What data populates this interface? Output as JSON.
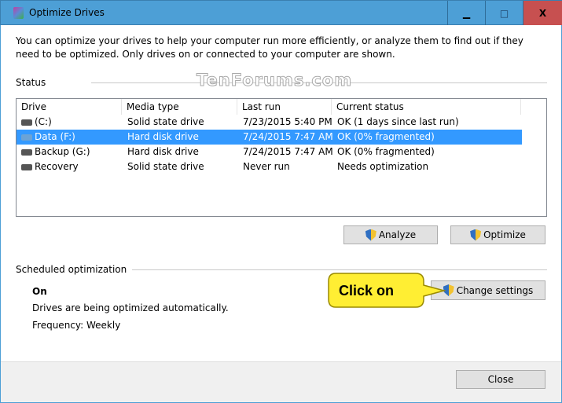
{
  "window": {
    "title": "Optimize Drives",
    "minimize": "▁",
    "maximize": "□",
    "close": "X"
  },
  "description": "You can optimize your drives to help your computer run more efficiently, or analyze them to find out if they need to be optimized. Only drives on or connected to your computer are shown.",
  "status_label": "Status",
  "watermark": "TenForums.com",
  "columns": [
    "Drive",
    "Media type",
    "Last run",
    "Current status"
  ],
  "drives": [
    {
      "drive": "(C:)",
      "media": "Solid state drive",
      "last_run": "7/23/2015 5:40 PM",
      "status": "OK (1 days since last run)",
      "selected": false,
      "icon": "system-drive-icon"
    },
    {
      "drive": "Data (F:)",
      "media": "Hard disk drive",
      "last_run": "7/24/2015 7:47 AM",
      "status": "OK (0% fragmented)",
      "selected": true,
      "icon": "hard-drive-icon"
    },
    {
      "drive": "Backup (G:)",
      "media": "Hard disk drive",
      "last_run": "7/24/2015 7:47 AM",
      "status": "OK (0% fragmented)",
      "selected": false,
      "icon": "hard-drive-icon"
    },
    {
      "drive": "Recovery",
      "media": "Solid state drive",
      "last_run": "Never run",
      "status": "Needs optimization",
      "selected": false,
      "icon": "hard-drive-icon"
    }
  ],
  "buttons": {
    "analyze": "Analyze",
    "optimize": "Optimize",
    "change_settings": "Change settings",
    "close": "Close"
  },
  "scheduled": {
    "label": "Scheduled optimization",
    "state": "On",
    "description": "Drives are being optimized automatically.",
    "frequency": "Frequency: Weekly"
  },
  "callout": "Click on",
  "colors": {
    "titlebar": "#4d9fd6",
    "close": "#c75050",
    "selection": "#3399ff",
    "callout": "#ffee33"
  }
}
